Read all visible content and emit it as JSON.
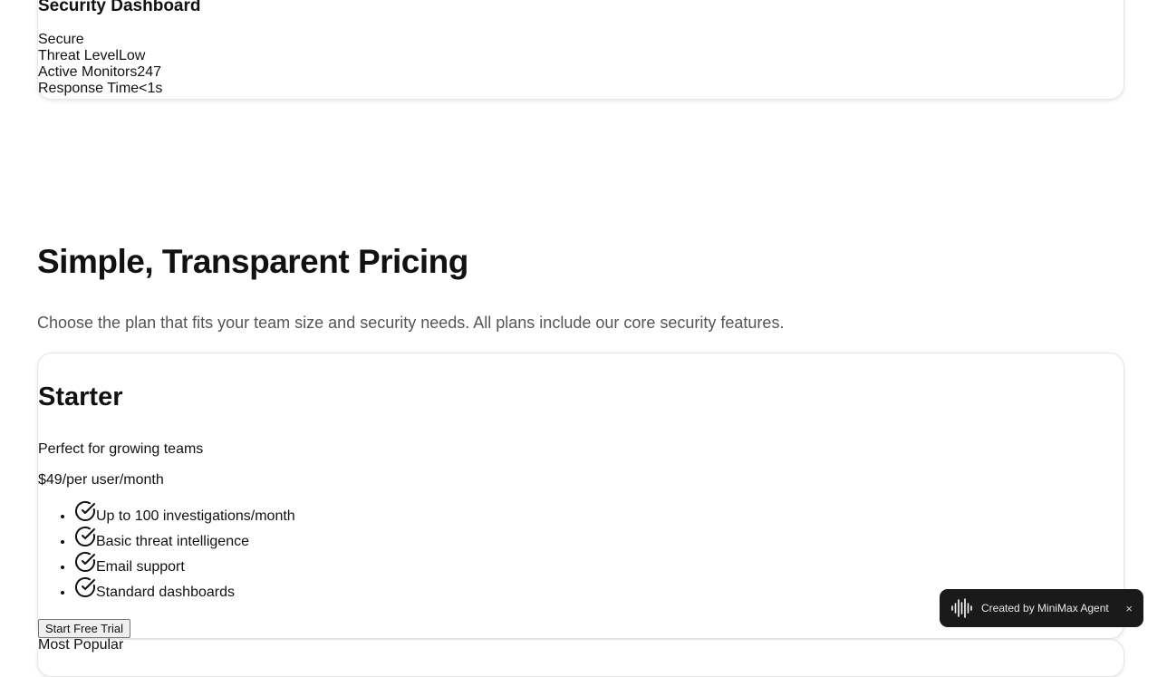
{
  "dashboard": {
    "title": "Security Dashboard",
    "status": "Secure",
    "stats": [
      {
        "label": "Threat Level",
        "value": "Low"
      },
      {
        "label": "Active Monitors",
        "value": "247"
      },
      {
        "label": "Response Time",
        "value": "<1s"
      }
    ]
  },
  "pricing": {
    "title": "Simple, Transparent Pricing",
    "subtitle": "Choose the plan that fits your team size and security needs. All plans include our core security features.",
    "plans": [
      {
        "name": "Starter",
        "description": "Perfect for growing teams",
        "price": "$49",
        "period": "/per user/month",
        "features": [
          "Up to 100 investigations/month",
          "Basic threat intelligence",
          "Email support",
          "Standard dashboards"
        ],
        "cta": "Start Free Trial"
      },
      {
        "badge": "Most Popular"
      }
    ]
  },
  "agent_badge": {
    "label": "Created by MiniMax Agent",
    "close": "×"
  },
  "icons": {
    "feature_check": "check-circle-icon",
    "agent_logo": "waveform-icon"
  }
}
